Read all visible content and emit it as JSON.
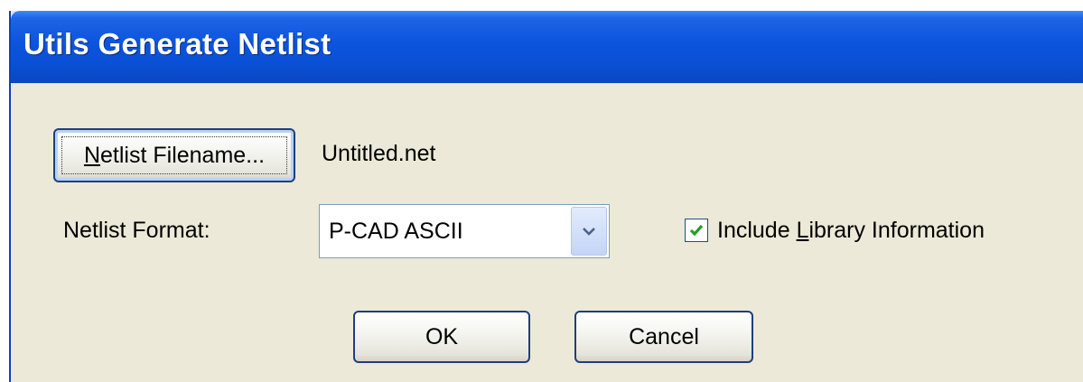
{
  "window": {
    "title": "Utils Generate Netlist"
  },
  "netlist_filename": {
    "button_mnemonic": "N",
    "button_rest": "etlist Filename...",
    "value": "Untitled.net"
  },
  "netlist_format": {
    "label": "Netlist Format:",
    "selected": "P-CAD ASCII"
  },
  "include_library": {
    "checked": true,
    "label_before": "Include ",
    "label_mnemonic": "L",
    "label_after": "ibrary Information"
  },
  "buttons": {
    "ok": "OK",
    "cancel": "Cancel"
  },
  "colors": {
    "titlebar": "#0a4fd6",
    "dialog_bg": "#ece9d8",
    "checkmark": "#21a121",
    "dropdown_arrow": "#4d6185"
  },
  "icons": {
    "dropdown": "chevron-down-icon",
    "check": "checkmark-icon"
  }
}
